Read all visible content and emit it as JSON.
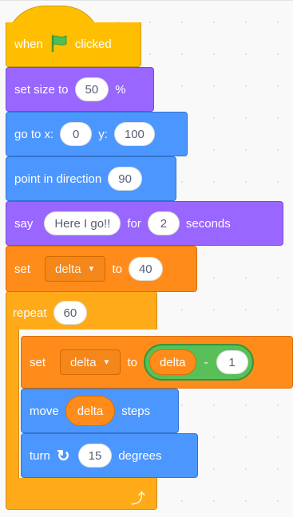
{
  "blocks": {
    "when_flag": {
      "text_when": "when",
      "text_clicked": "clicked",
      "flag_icon": "green-flag-icon"
    },
    "set_size": {
      "label": "set size to",
      "value": "50",
      "unit": "%"
    },
    "go_to": {
      "label": "go to x:",
      "x": "0",
      "y_label": "y:",
      "y": "100"
    },
    "point_dir": {
      "label": "point in direction",
      "value": "90"
    },
    "say": {
      "label": "say",
      "message": "Here I go!!",
      "for_label": "for",
      "secs": "2",
      "seconds_label": "seconds"
    },
    "set_var1": {
      "label": "set",
      "variable": "delta",
      "to_label": "to",
      "value": "40"
    },
    "repeat": {
      "label": "repeat",
      "times": "60",
      "loop_icon": "loop-arrow-icon"
    },
    "set_var2": {
      "label": "set",
      "variable": "delta",
      "to_label": "to",
      "op_var": "delta",
      "op_sign": "-",
      "op_value": "1"
    },
    "move": {
      "label": "move",
      "var": "delta",
      "steps_label": "steps"
    },
    "turn": {
      "label": "turn",
      "icon": "rotate-clockwise-icon",
      "value": "15",
      "degrees_label": "degrees"
    }
  },
  "colors": {
    "events": "#ffbf00",
    "looks": "#9966ff",
    "motion": "#4c97ff",
    "variables": "#ff8c1a",
    "control": "#ffab19",
    "operators": "#59c059"
  }
}
